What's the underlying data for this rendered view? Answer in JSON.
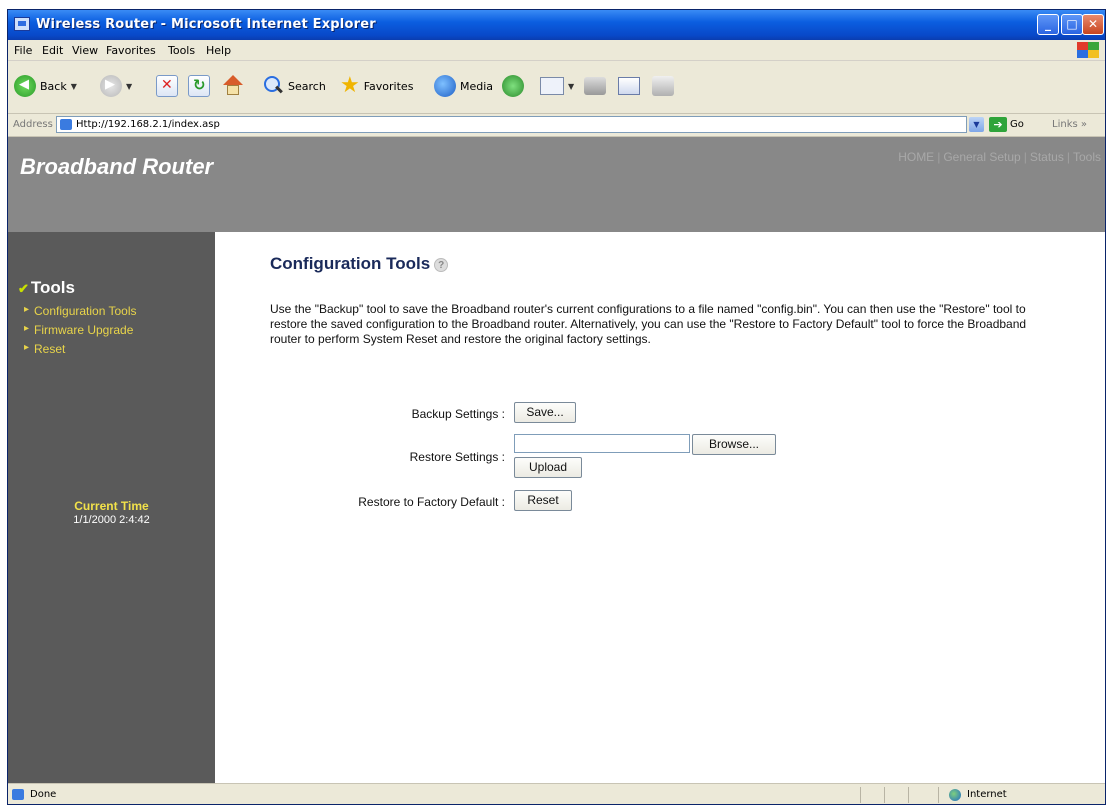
{
  "window": {
    "title": "Wireless Router - Microsoft Internet Explorer",
    "controls": [
      "minimize",
      "maximize",
      "close"
    ]
  },
  "menubar": {
    "items": [
      "File",
      "Edit",
      "View",
      "Favorites",
      "Tools",
      "Help"
    ]
  },
  "toolbar": {
    "back_label": "Back",
    "search_label": "Search",
    "favorites_label": "Favorites",
    "media_label": "Media"
  },
  "addressbar": {
    "label": "Address",
    "url": "Http://192.168.2.1/index.asp",
    "go_label": "Go",
    "links_label": "Links"
  },
  "header": {
    "brand": "Broadband Router",
    "nav": [
      "HOME",
      "General Setup",
      "Status",
      "Tools"
    ]
  },
  "sidebar": {
    "section_title": "Tools",
    "items": [
      "Configuration Tools",
      "Firmware Upgrade",
      "Reset"
    ],
    "current_time_label": "Current Time",
    "current_time_value": "1/1/2000 2:4:42"
  },
  "content": {
    "title": "Configuration Tools",
    "description": "Use the \"Backup\" tool to save the Broadband router's current configurations to a file named \"config.bin\". You can then use the \"Restore\" tool to restore the saved configuration to the Broadband router. Alternatively, you can use the \"Restore to Factory Default\" tool to force the Broadband router to perform System Reset and restore the original factory settings.",
    "backup_label": "Backup Settings :",
    "backup_button": "Save...",
    "restore_label": "Restore Settings :",
    "restore_file_value": "",
    "browse_button": "Browse...",
    "upload_button": "Upload",
    "factory_label": "Restore to Factory Default :",
    "reset_button": "Reset"
  },
  "statusbar": {
    "status": "Done",
    "zone": "Internet"
  }
}
